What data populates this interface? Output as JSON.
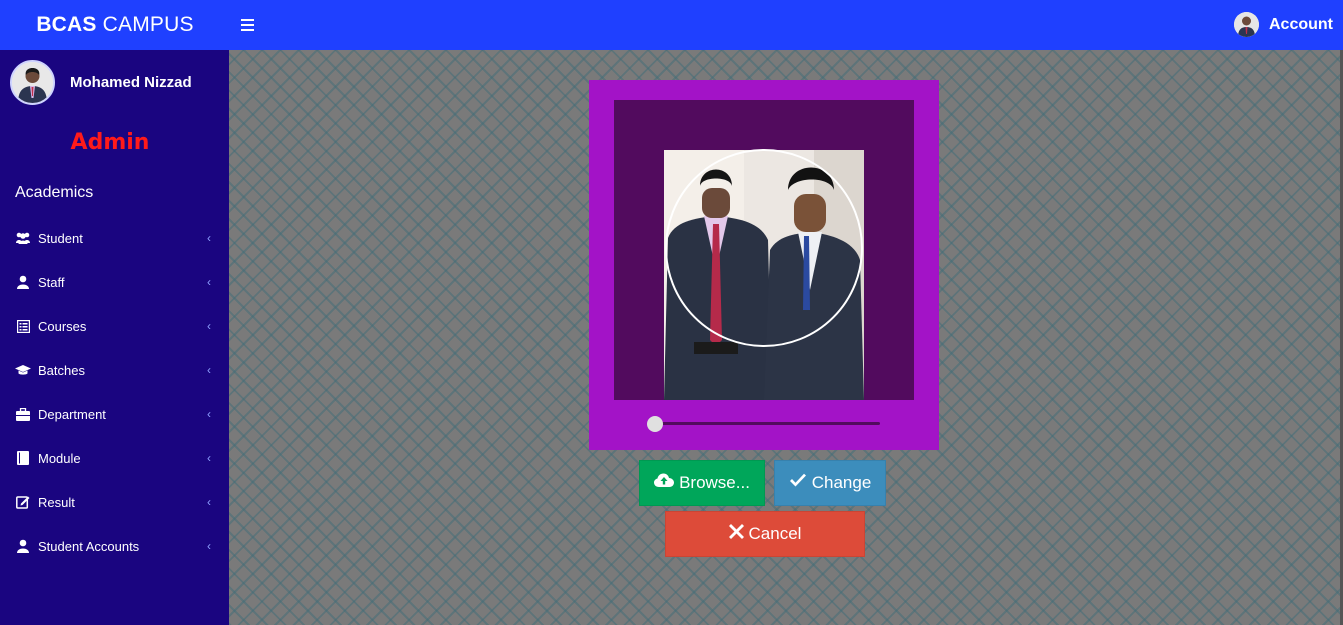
{
  "header": {
    "brand_bold": "BCAS",
    "brand_rest": "CAMPUS",
    "account_label": "Account"
  },
  "sidebar": {
    "user_name": "Mohamed Nizzad",
    "role": "Admin",
    "section_title": "Academics",
    "items": [
      {
        "label": "Student",
        "icon": "users-icon"
      },
      {
        "label": "Staff",
        "icon": "user-icon"
      },
      {
        "label": "Courses",
        "icon": "list-icon"
      },
      {
        "label": "Batches",
        "icon": "graduation-cap-icon"
      },
      {
        "label": "Department",
        "icon": "briefcase-icon"
      },
      {
        "label": "Module",
        "icon": "book-icon"
      },
      {
        "label": "Result",
        "icon": "edit-icon"
      },
      {
        "label": "Student Accounts",
        "icon": "user-icon"
      }
    ]
  },
  "cropper": {
    "zoom_level": 0
  },
  "buttons": {
    "browse_label": "Browse...",
    "change_label": "Change",
    "cancel_label": "Cancel"
  },
  "colors": {
    "header": "#1f40ff",
    "sidebar": "#1a0580",
    "role": "#ff1a1a",
    "cropper_frame": "#a313c7",
    "cropper_canvas": "#520b5e",
    "browse": "#00a65a",
    "change": "#3c8dbc",
    "cancel": "#dd4b39"
  }
}
